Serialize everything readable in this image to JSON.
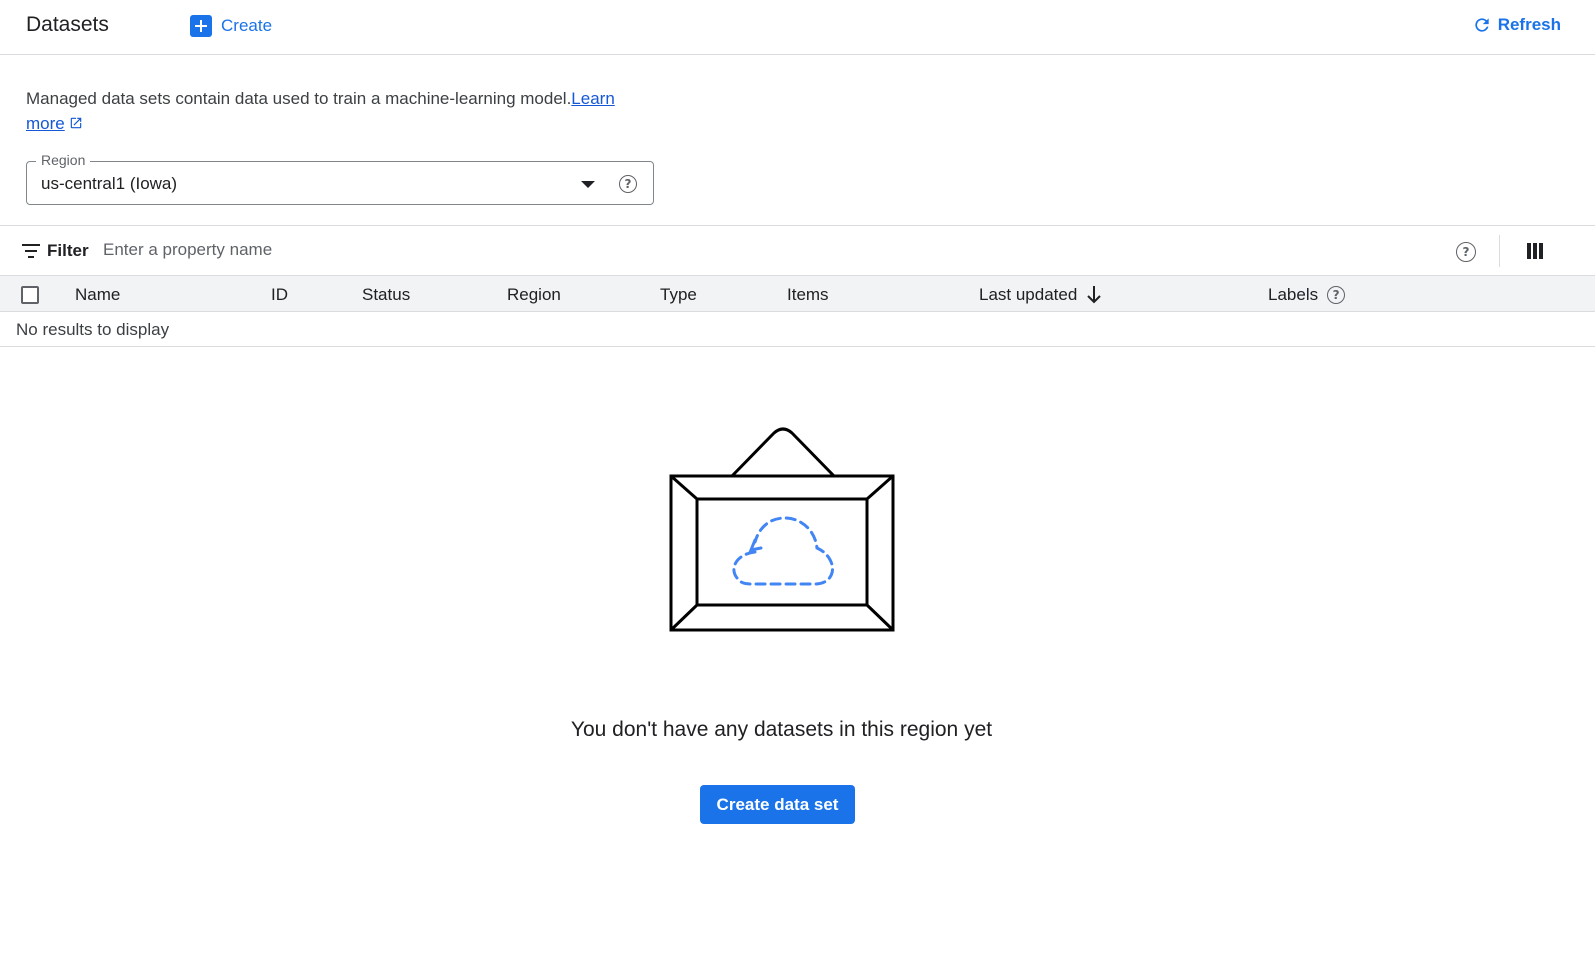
{
  "header": {
    "title": "Datasets",
    "create_label": "Create",
    "refresh_label": "Refresh"
  },
  "description": {
    "text": "Managed data sets contain data used to train a machine-learning model.",
    "link_label_1": "Learn",
    "link_label_2": "more"
  },
  "region": {
    "label": "Region",
    "value": "us-central1 (Iowa)"
  },
  "filter": {
    "label": "Filter",
    "placeholder": "Enter a property name"
  },
  "table": {
    "columns": [
      "Name",
      "ID",
      "Status",
      "Region",
      "Type",
      "Items",
      "Last updated",
      "Labels"
    ],
    "empty_text": "No results to display"
  },
  "empty_state": {
    "message": "You don't have any datasets in this region yet",
    "button_label": "Create data set"
  },
  "colors": {
    "accent": "#1a73e8",
    "border": "#dadce0",
    "header_bg": "#f1f3f4"
  }
}
